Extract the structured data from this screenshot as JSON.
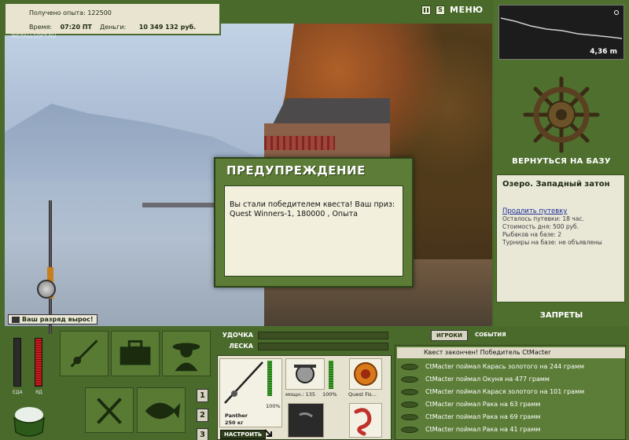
{
  "stats": {
    "xp_label": "Получено опыта:",
    "xp_value": "122500",
    "time_label": "Время:",
    "time_value": "07:20 ПТ",
    "money_label": "Деньги:",
    "money_value": "10 349 132 руб."
  },
  "watermark": "INSTALLSOFT.RU",
  "top_menu": {
    "pause_icon": "pause-icon",
    "s_icon_text": "S",
    "menu_label": "МЕНЮ"
  },
  "depth": {
    "value": "4,36 m"
  },
  "right_panel": {
    "return_label": "ВЕРНУТЬСЯ НА БАЗУ",
    "location_name": "Озеро. Западный затон",
    "extend_trip_link": "Продлить путевку",
    "info_lines": [
      "Осталось путевки: 18 час.",
      "Стоимость дня: 500 руб.",
      "Рыбаков на базе: 2",
      "Турниры на базе: не объявлены"
    ],
    "bans_label": "ЗАПРЕТЫ"
  },
  "dialog": {
    "title": "ПРЕДУПРЕЖДЕНИЕ",
    "message": "Вы стали победителем квеста! Ваш приз: Quest Winners-1, 180000 , Опыта"
  },
  "rank_message": "Ваш разряд вырос!",
  "meters": {
    "food_label": "ЕДА",
    "poison_label": "ЯД",
    "food_level": 0.0,
    "poison_level": 1.0
  },
  "slot_numbers": [
    "1",
    "2",
    "3"
  ],
  "tackle": {
    "rod_label": "УДОЧКА",
    "line_label": "ЛЕСКА",
    "rod_name": "Panther",
    "rod_weight": "250 кг",
    "rod_percent": "100%",
    "reel_info": "мощн.: 135",
    "reel_percent": "100%",
    "lure_name": "Quest Fis...",
    "tune_label": "НАСТРОИТЬ"
  },
  "events": {
    "tab_players": "ИГРОКИ",
    "tab_events": "СОБЫТИЯ",
    "header": "Квест закончен! Победитель CtMacter",
    "rows": [
      "CtMacter поймал Карась золотого на 244 грамм",
      "CtMacter поймал Окуня на 477 грамм",
      "CtMacter поймал Карася золотого на 101 грамм",
      "CtMacter поймал Рака на 63 грамм",
      "CtMacter поймал Рака на 69 грамм",
      "CtMacter поймал Рака на 41 грамм"
    ]
  },
  "colors": {
    "panel_green": "#4a6a2c",
    "paper": "#e9e7d6",
    "link_blue": "#1a2d9a"
  }
}
